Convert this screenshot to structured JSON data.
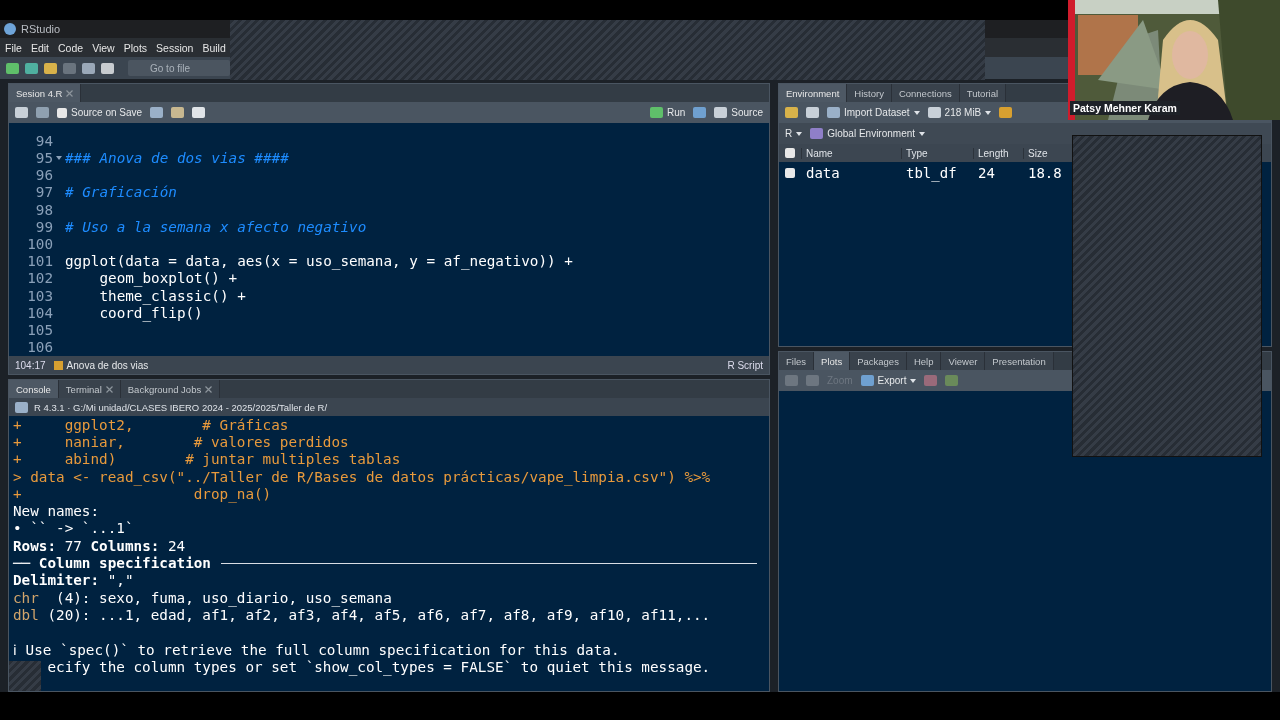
{
  "app": {
    "title": "RStudio"
  },
  "menu": [
    "File",
    "Edit",
    "Code",
    "View",
    "Plots",
    "Session",
    "Build"
  ],
  "toolbar": {
    "goto": "Go to file"
  },
  "source": {
    "tabs": [
      {
        "label": "Sesion 4.R",
        "selected": true
      }
    ],
    "source_on_save": {
      "label": "Source on Save",
      "checked": false
    },
    "run": "Run",
    "source_button": "Source",
    "lines": [
      {
        "number": "94"
      },
      {
        "number": "95",
        "kind": "comment",
        "text": "### Anova de dos vias ####",
        "foldable": true
      },
      {
        "number": "96"
      },
      {
        "number": "97",
        "kind": "comment",
        "text": "# Graficación"
      },
      {
        "number": "98"
      },
      {
        "number": "99",
        "kind": "comment",
        "text": "# Uso a la semana x afecto negativo"
      },
      {
        "number": "100"
      },
      {
        "number": "101",
        "kind": "code",
        "text": "ggplot(data = data, aes(x = uso_semana, y = af_negativo)) +"
      },
      {
        "number": "102",
        "kind": "code",
        "text": "    geom_boxplot() +"
      },
      {
        "number": "103",
        "kind": "code",
        "text": "    theme_classic() +"
      },
      {
        "number": "104",
        "kind": "code",
        "text": "    coord_flip()"
      },
      {
        "number": "105"
      },
      {
        "number": "106"
      }
    ],
    "status": {
      "position": "104:17",
      "section": "Anova de dos vias",
      "filetype": "R Script"
    }
  },
  "console": {
    "tabs": [
      {
        "label": "Console",
        "selected": true,
        "closable": false
      },
      {
        "label": "Terminal",
        "selected": false,
        "closable": true
      },
      {
        "label": "Background Jobs",
        "selected": false,
        "closable": true
      }
    ],
    "path": "R 4.3.1 · G:/Mi unidad/CLASES IBERO 2024 - 2025/2025/Taller de R/",
    "lines": [
      {
        "kind": "input",
        "text": "+     ggplot2,        # Gráficas"
      },
      {
        "kind": "input",
        "text": "+     naniar,        # valores perdidos"
      },
      {
        "kind": "input",
        "text": "+     abind)        # juntar multiples tablas"
      },
      {
        "kind": "input",
        "text": "> data <- read_csv(\"../Taller de R/Bases de datos prácticas/vape_limpia.csv\") %>%"
      },
      {
        "kind": "input",
        "text": "+                    drop_na()"
      },
      {
        "kind": "output",
        "text": "New names:"
      },
      {
        "kind": "output",
        "text": "• `` -> `...1`"
      },
      {
        "kind": "output",
        "text": "**Rows:** 77 **Columns:** 24"
      },
      {
        "kind": "rule",
        "text": "── Column specification"
      },
      {
        "kind": "output",
        "text": "**Delimiter:** \",\""
      },
      {
        "kind": "coltype",
        "prefix": "chr",
        "text": "  (4): sexo, fuma, uso_diario, uso_semana"
      },
      {
        "kind": "coltype",
        "prefix": "dbl",
        "text": " (20): ...1, edad, af1, af2, af3, af4, af5, af6, af7, af8, af9, af10, af11,..."
      },
      {
        "kind": "output"
      },
      {
        "kind": "output",
        "text": "ℹ Use `spec()` to retrieve the full column specification for this data."
      },
      {
        "kind": "output",
        "text": "    ecify the column types or set `show_col_types = FALSE` to quiet this message."
      }
    ]
  },
  "environment": {
    "tabs": [
      {
        "label": "Environment",
        "selected": true
      },
      {
        "label": "History",
        "selected": false
      },
      {
        "label": "Connections",
        "selected": false
      },
      {
        "label": "Tutorial",
        "selected": false
      }
    ],
    "import": "Import Dataset",
    "memory": "218 MiB",
    "language": "R",
    "scope": "Global Environment",
    "select_all": {
      "checked": false
    },
    "columns": [
      "Name",
      "Type",
      "Length",
      "Size"
    ],
    "rows": [
      {
        "checked": false,
        "cells": [
          "data",
          "tbl_df",
          "24",
          "18.8"
        ]
      }
    ]
  },
  "files": {
    "tabs": [
      {
        "label": "Files",
        "selected": false
      },
      {
        "label": "Plots",
        "selected": true
      },
      {
        "label": "Packages",
        "selected": false
      },
      {
        "label": "Help",
        "selected": false
      },
      {
        "label": "Viewer",
        "selected": false
      },
      {
        "label": "Presentation",
        "selected": false
      }
    ],
    "zoom": {
      "label": "Zoom",
      "disabled": true
    },
    "export": "Export"
  },
  "webcam": {
    "name": "Patsy Mehner Karam"
  }
}
